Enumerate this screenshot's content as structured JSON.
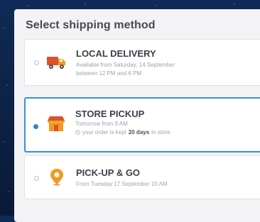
{
  "page": {
    "title": "Select shipping method"
  },
  "options": [
    {
      "id": "local-delivery",
      "title": "LOCAL DELIVERY",
      "line1": "Available from Saturday, 14 September",
      "line2": "between 12 PM and 6 PM",
      "selected": false,
      "icon": "truck-icon"
    },
    {
      "id": "store-pickup",
      "title": "STORE PICKUP",
      "line1": "Tomorrow from 9 AM",
      "keep_prefix": "your order is kept",
      "keep_days": "20 days",
      "keep_suffix": "in store",
      "selected": true,
      "icon": "store-icon"
    },
    {
      "id": "pickup-and-go",
      "title": "PICK-UP & GO",
      "line1": "From Tuesday 17 September 10 AM",
      "selected": false,
      "icon": "location-pin-icon"
    }
  ],
  "colors": {
    "accent": "#3b8fd6",
    "icon_orange": "#f39a1e",
    "icon_red": "#d9532b"
  }
}
